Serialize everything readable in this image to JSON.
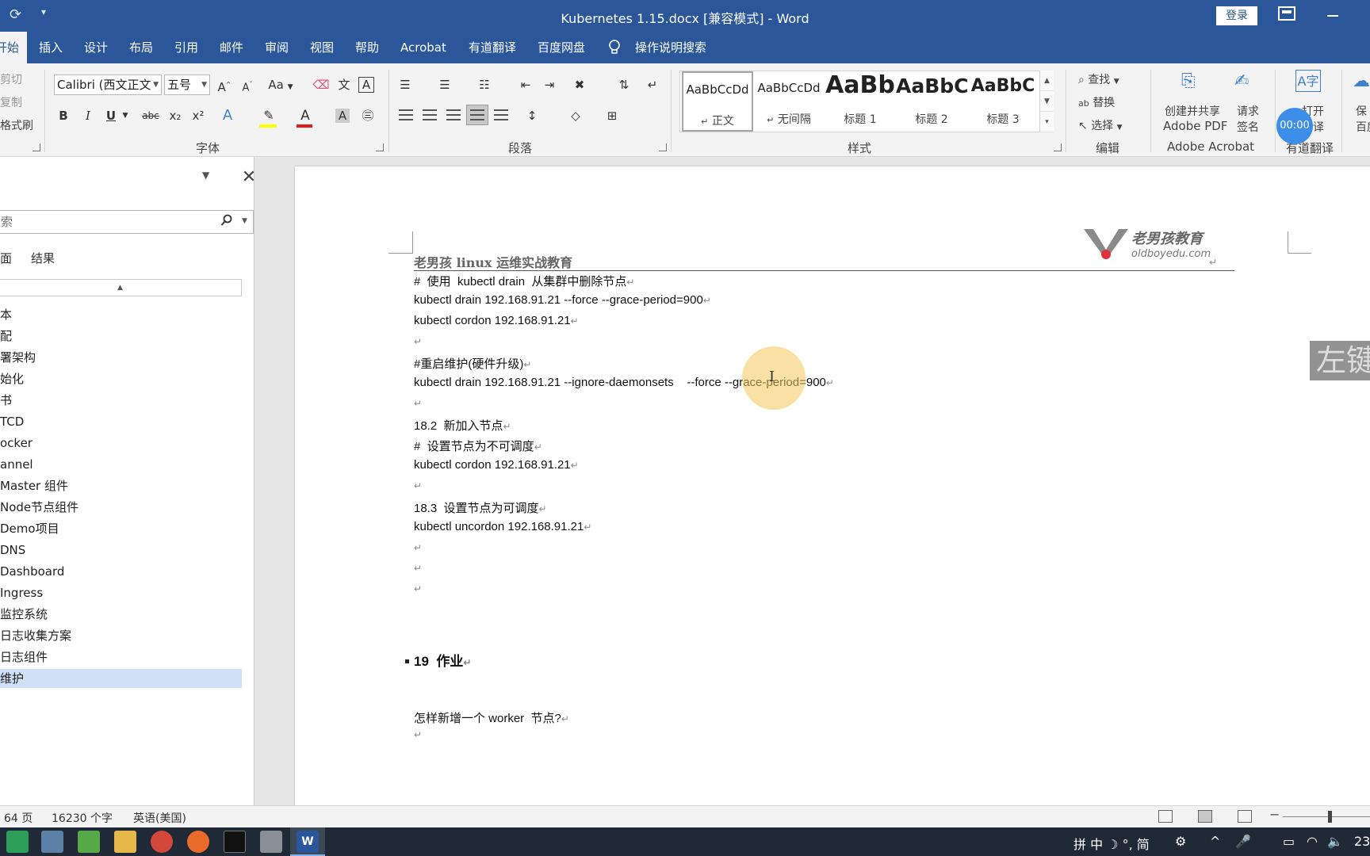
{
  "window": {
    "title": "Kubernetes 1.15.docx [兼容模式]  -  Word",
    "login_label": "登录",
    "qa_icons": [
      "autosave-icon",
      "customize-qa-icon"
    ]
  },
  "tabs": [
    {
      "label": "开始",
      "active": true
    },
    {
      "label": "插入"
    },
    {
      "label": "设计"
    },
    {
      "label": "布局"
    },
    {
      "label": "引用"
    },
    {
      "label": "邮件"
    },
    {
      "label": "审阅"
    },
    {
      "label": "视图"
    },
    {
      "label": "帮助"
    },
    {
      "label": "Acrobat"
    },
    {
      "label": "有道翻译"
    },
    {
      "label": "百度网盘"
    }
  ],
  "tell_me": "操作说明搜索",
  "ribbon": {
    "clipboard": {
      "cut": "剪切",
      "copy": "复制",
      "format_painter": "格式刷"
    },
    "font": {
      "label": "字体",
      "font_name": "Calibri (西文正文",
      "font_size": "五号",
      "grow": "A",
      "shrink": "A",
      "case": "Aa",
      "bold": "B",
      "italic": "I",
      "underline": "U",
      "strike": "abc",
      "subscript": "x₂",
      "superscript": "x²",
      "font_color_letter": "A",
      "highlight_color": "#ffff00",
      "font_color": "#e01b1b"
    },
    "paragraph": {
      "label": "段落"
    },
    "styles": {
      "label": "样式",
      "items": [
        {
          "preview": "AaBbCcDd",
          "name": "正文",
          "mark": "↵"
        },
        {
          "preview": "AaBbCcDd",
          "name": "无间隔",
          "mark": "↵"
        },
        {
          "preview": "AaBb",
          "name": "标题 1"
        },
        {
          "preview": "AaBbC",
          "name": "标题 2"
        },
        {
          "preview": "AaBbC",
          "name": "标题 3"
        }
      ]
    },
    "editing": {
      "label": "编辑",
      "find": "查找",
      "replace": "替换",
      "select": "选择"
    },
    "acrobat": {
      "label": "Adobe Acrobat",
      "create_share_1": "创建并共享",
      "create_share_2": "Adobe PDF",
      "request_1": "请求",
      "request_2": "签名"
    },
    "youdao": {
      "label": "有道翻译",
      "open_1": "打开",
      "open_2": "翻译"
    },
    "baidu": {
      "save_1": "保",
      "save_2": "百度"
    }
  },
  "nav_pane": {
    "search_placeholder": "索",
    "tabs": [
      "面",
      "结果"
    ],
    "items": [
      "本",
      "配",
      "署架构",
      "始化",
      "书",
      "TCD",
      "ocker",
      "annel",
      "Master 组件",
      "Node节点组件",
      "Demo项目",
      "DNS",
      "Dashboard",
      "Ingress",
      "监控系统",
      "日志收集方案",
      "日志组件",
      "维护"
    ],
    "selected_index": 17
  },
  "document": {
    "header": "老男孩 linux 运维实战教育",
    "logo_name": "老男孩教育",
    "logo_url": "oldboyedu.com",
    "para_mark": "↵",
    "lines": [
      "#  使用  kubectl drain  从集群中删除节点",
      "kubectl drain 192.168.91.21 --force --grace-period=900",
      "kubectl cordon 192.168.91.21",
      "",
      "#重启维护(硬件升级)",
      "kubectl drain 192.168.91.21 --ignore-daemonsets    --force --grace-period=900",
      "",
      "18.2  新加入节点",
      "#  设置节点为不可调度",
      "kubectl cordon 192.168.91.21",
      "",
      "18.3  设置节点为可调度",
      "kubectl uncordon 192.168.91.21",
      "",
      "",
      ""
    ],
    "heading": "19  作业",
    "question": "怎样新增一个 worker  节点?"
  },
  "overlay": {
    "left_click": "左键",
    "timer": "00:00"
  },
  "status": {
    "page": "64 页",
    "words": "16230 个字",
    "language": "英语(美国)"
  },
  "tray": {
    "ime": "拼 中 ☽ °, 简",
    "clock": "23"
  }
}
